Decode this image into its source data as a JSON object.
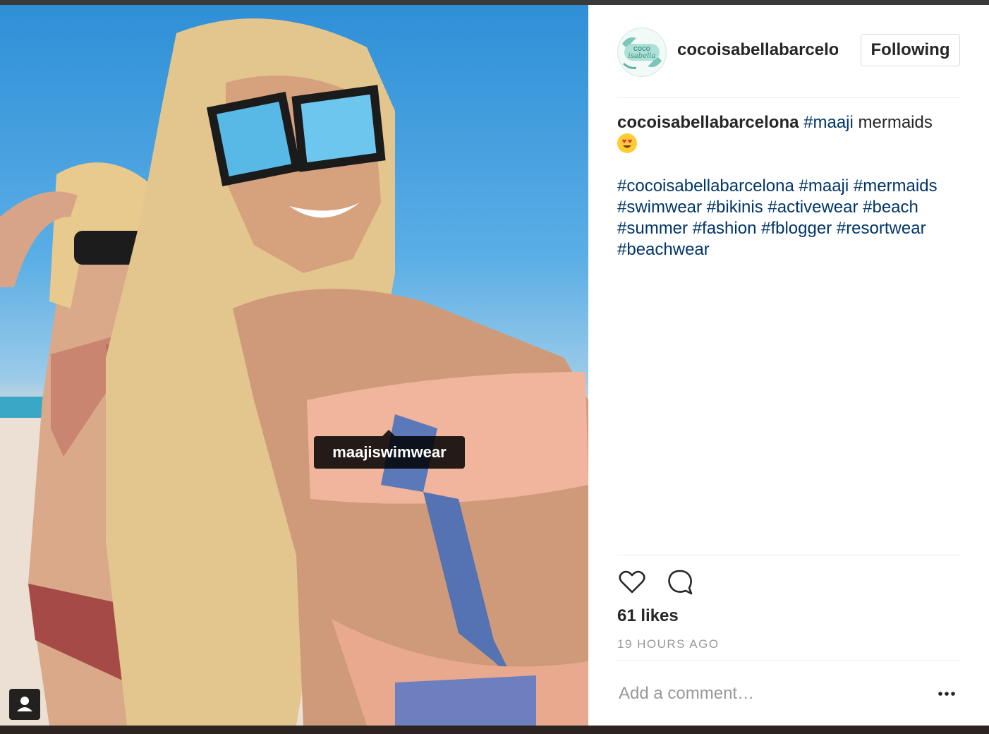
{
  "post": {
    "tag_label": "maajiswimwear",
    "user_tag_icon": "person-icon"
  },
  "header": {
    "username": "cocoisabellabarcelona",
    "avatar_text_top": "COCO",
    "avatar_text_script": "isabella",
    "follow_button": "Following"
  },
  "caption": {
    "author": "cocoisabellabarcelona",
    "hashtag_1": "#maaji",
    "text": "mermaids",
    "emoji": "heart-eyes-emoji",
    "hashtags": "#cocoisabellabarcelona #maaji #mermaids #swimwear #bikinis #activewear #beach #summer #fashion #fblogger #resortwear #beachwear"
  },
  "actions": {
    "like_icon": "heart-icon",
    "comment_icon": "comment-icon"
  },
  "likes": "61 likes",
  "timestamp": "19 HOURS AGO",
  "comment": {
    "placeholder": "Add a comment…",
    "more_icon": "more-options-icon"
  },
  "colors": {
    "hashtag": "#003569",
    "text": "#262626",
    "muted": "#999999",
    "border": "#dbdbdb"
  }
}
